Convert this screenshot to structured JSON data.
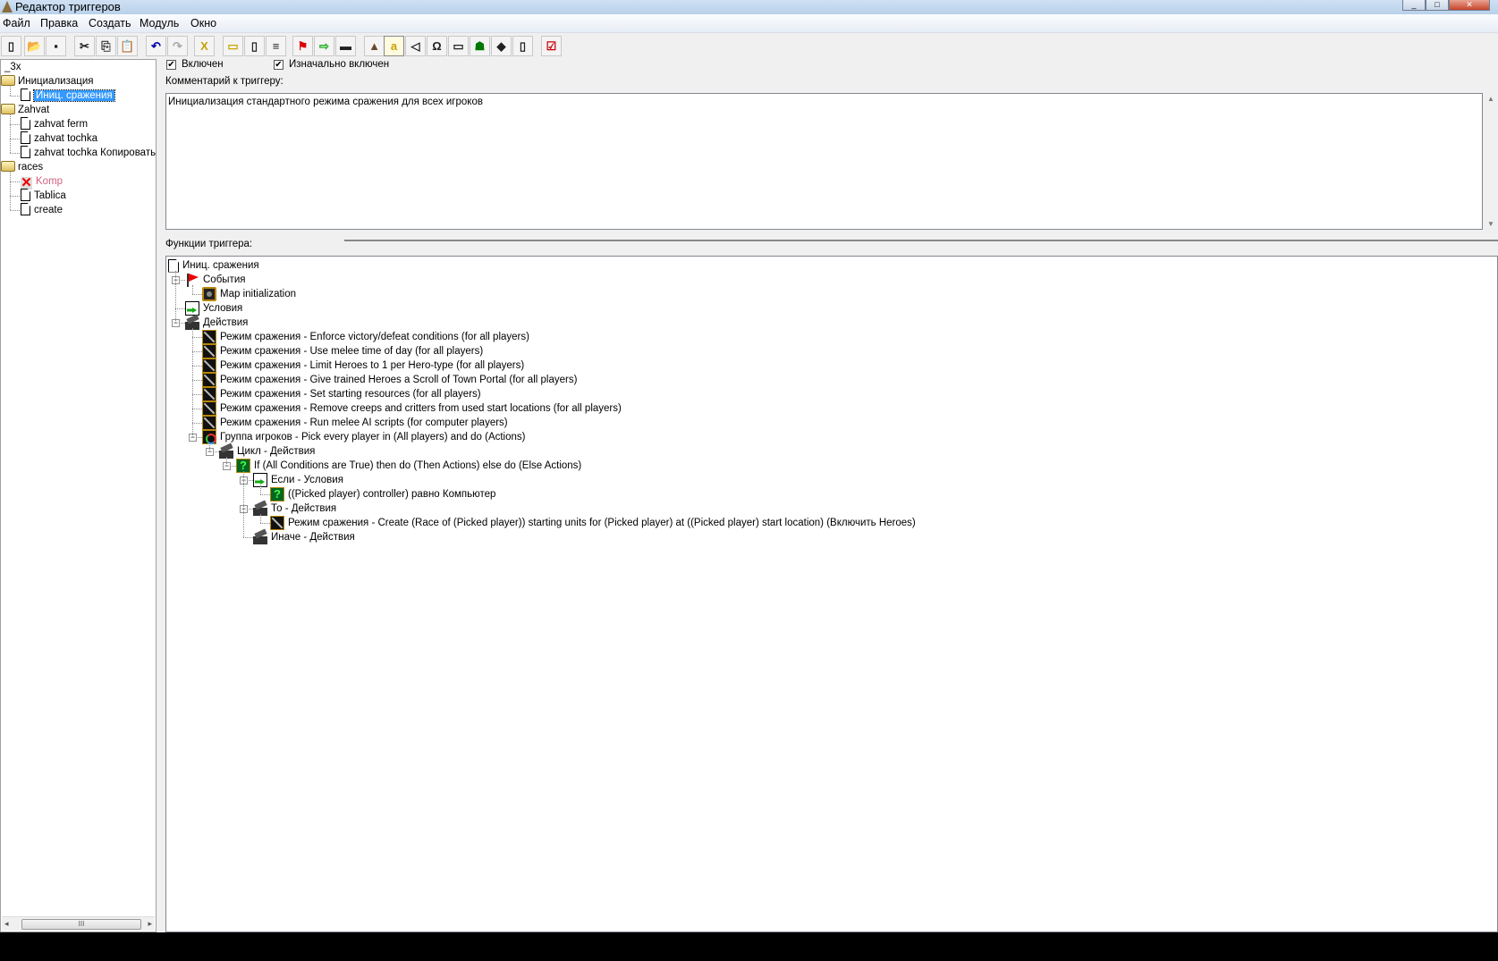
{
  "window": {
    "title": "Редактор триггеров",
    "controls": [
      "_",
      "□",
      "✕"
    ]
  },
  "menu": [
    "Файл",
    "Правка",
    "Создать",
    "Модуль",
    "Окно"
  ],
  "toolbar": {
    "icons": [
      "new-icon",
      "open-icon",
      "save-icon",
      "cut-icon",
      "copy-icon",
      "paste-icon",
      "undo-icon",
      "redo-icon",
      "delete-icon",
      "new-category-icon",
      "new-trigger-icon",
      "new-comment-icon",
      "new-event-icon",
      "new-condition-icon",
      "new-action-icon",
      "terrain-editor-icon",
      "trigger-editor-icon",
      "sound-editor-icon",
      "object-editor-icon",
      "campaign-editor-icon",
      "ai-editor-icon",
      "object-manager-icon",
      "import-manager-icon",
      "test-map-icon"
    ],
    "x_label": "X",
    "a_label": "a"
  },
  "left_tree": {
    "root": "3x",
    "items": [
      {
        "label": "Инициализация",
        "type": "folder",
        "level": 0
      },
      {
        "label": "Иниц. сражения",
        "type": "trigger",
        "level": 1,
        "selected": true
      },
      {
        "label": "Zahvat",
        "type": "folder",
        "level": 0
      },
      {
        "label": "zahvat ferm",
        "type": "trigger",
        "level": 1
      },
      {
        "label": "zahvat tochka",
        "type": "trigger",
        "level": 1
      },
      {
        "label": "zahvat tochka Копировать",
        "type": "trigger",
        "level": 1
      },
      {
        "label": "races",
        "type": "folder",
        "level": 0
      },
      {
        "label": "Komp",
        "type": "disabled",
        "level": 1
      },
      {
        "label": "Tablica",
        "type": "trigger",
        "level": 1
      },
      {
        "label": "create",
        "type": "trigger",
        "level": 1
      }
    ],
    "scroll_grip": "III"
  },
  "options": {
    "enabled_label": "Включен",
    "enabled": true,
    "initially_on_label": "Изначально включен",
    "initially_on": true
  },
  "comment": {
    "label": "Комментарий к триггеру:",
    "value": "Инициализация стандартного режима сражения для всех игроков"
  },
  "functions": {
    "label": "Функции триггера:",
    "rows": [
      {
        "level": 0,
        "icon": "doc",
        "label": "Иниц. сражения"
      },
      {
        "level": 1,
        "icon": "flag",
        "label": "События",
        "expander": "−"
      },
      {
        "level": 2,
        "icon": "gear",
        "label": "Map initialization"
      },
      {
        "level": 1,
        "icon": "cond",
        "label": "Условия"
      },
      {
        "level": 1,
        "icon": "act",
        "label": "Действия",
        "expander": "−"
      },
      {
        "level": 2,
        "icon": "sword",
        "label": "Режим сражения - Enforce victory/defeat conditions (for all players)"
      },
      {
        "level": 2,
        "icon": "sword",
        "label": "Режим сражения - Use melee time of day (for all players)"
      },
      {
        "level": 2,
        "icon": "sword",
        "label": "Режим сражения - Limit Heroes to 1 per Hero-type (for all players)"
      },
      {
        "level": 2,
        "icon": "sword",
        "label": "Режим сражения - Give trained Heroes a Scroll of Town Portal (for all players)"
      },
      {
        "level": 2,
        "icon": "sword",
        "label": "Режим сражения - Set starting resources (for all players)"
      },
      {
        "level": 2,
        "icon": "sword",
        "label": "Режим сражения - Remove creeps and critters from used start locations (for all players)"
      },
      {
        "level": 2,
        "icon": "sword",
        "label": "Режим сражения - Run melee AI scripts (for computer players)"
      },
      {
        "level": 2,
        "icon": "group",
        "label": "Группа игроков - Pick every player in (All players) and do (Actions)",
        "expander": "−"
      },
      {
        "level": 3,
        "icon": "act",
        "label": "Цикл - Действия",
        "expander": "−"
      },
      {
        "level": 4,
        "icon": "q",
        "label": "If (All Conditions are True) then do (Then Actions) else do (Else Actions)",
        "expander": "−"
      },
      {
        "level": 5,
        "icon": "cond",
        "label": "Если - Условия",
        "expander": "−"
      },
      {
        "level": 6,
        "icon": "q",
        "label": "((Picked player) controller) равно Компьютер"
      },
      {
        "level": 5,
        "icon": "act",
        "label": "То - Действия",
        "expander": "−"
      },
      {
        "level": 6,
        "icon": "sword",
        "label": "Режим сражения - Create (Race of (Picked player)) starting units for (Picked player) at ((Picked player) start location) (Включить Heroes)"
      },
      {
        "level": 5,
        "icon": "act",
        "label": "Иначе - Действия"
      }
    ]
  },
  "colors": {
    "selection": "#3399ff",
    "disabled_text": "#d06080"
  }
}
